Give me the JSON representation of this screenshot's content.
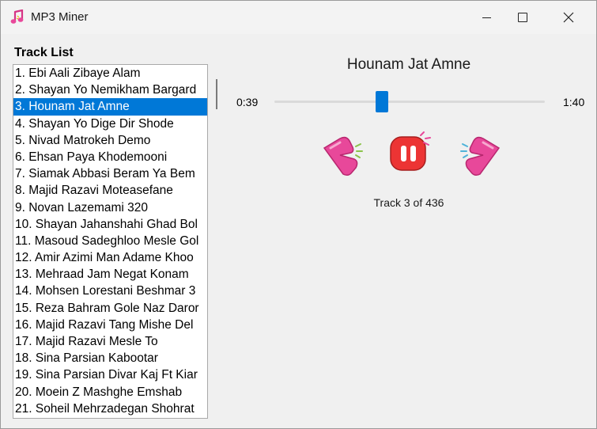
{
  "window": {
    "title": "MP3 Miner"
  },
  "tracklist": {
    "label": "Track List",
    "items": [
      "1. Ebi Aali Zibaye Alam",
      "2. Shayan Yo Nemikham Bargard",
      "3. Hounam Jat Amne",
      "4. Shayan Yo Dige Dir Shode",
      "5. Nivad Matrokeh Demo",
      "6. Ehsan Paya Khodemooni",
      "7. Siamak Abbasi Beram Ya Bem",
      "8. Majid Razavi Moteasefane",
      "9. Novan Lazemami 320",
      "10. Shayan Jahanshahi Ghad Bol",
      "11. Masoud Sadeghloo Mesle Gol",
      "12. Amir Azimi Man Adame Khoo",
      "13. Mehraad Jam Negat Konam",
      "14. Mohsen Lorestani Beshmar 3",
      "15. Reza Bahram Gole Naz Daror",
      "16. Majid Razavi Tang Mishe Del",
      "17. Majid Razavi Mesle To",
      "18. Sina Parsian Kabootar",
      "19. Sina Parsian Divar Kaj Ft Kiar",
      "20. Moein Z Mashghe Emshab",
      "21. Soheil Mehrzadegan Shohrat"
    ],
    "selected_index": 2
  },
  "player": {
    "now_playing": "Hounam Jat Amne",
    "current_time": "0:39",
    "total_time": "1:40",
    "progress_fraction": 0.39,
    "track_info": "Track 3 of 436"
  },
  "colors": {
    "accent": "#0078d7",
    "control_pink": "#e8489a",
    "control_red": "#ec3434"
  }
}
